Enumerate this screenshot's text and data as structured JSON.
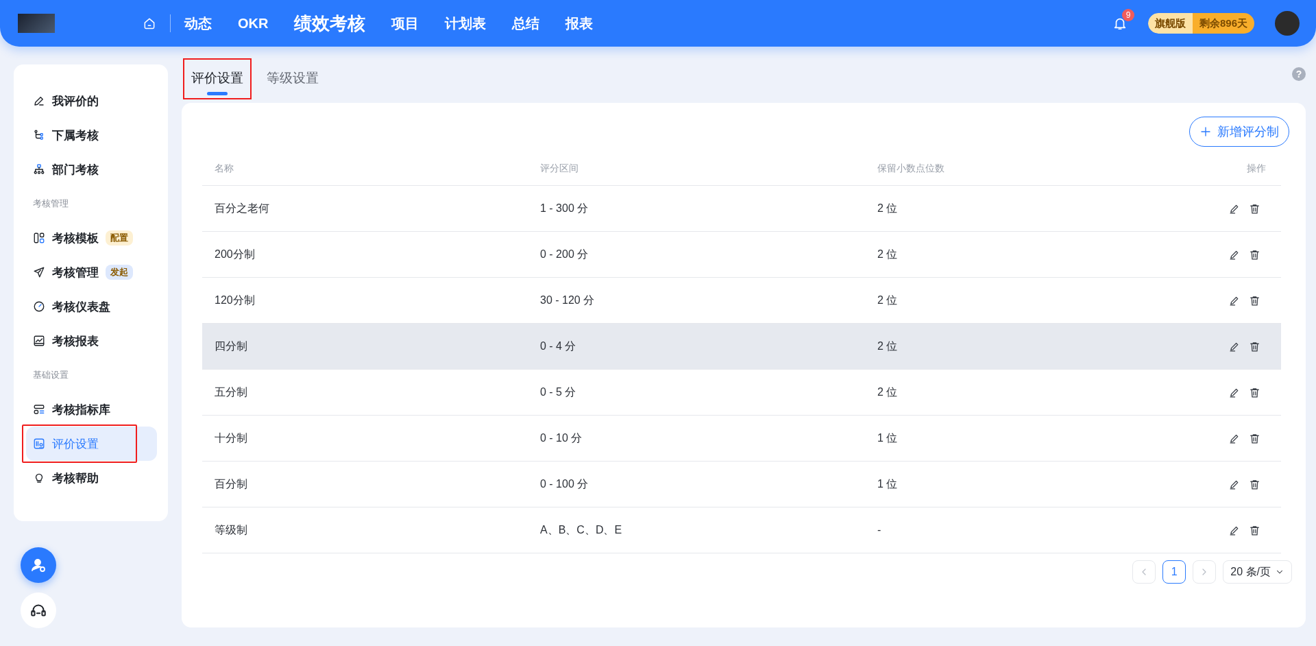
{
  "header": {
    "nav": [
      {
        "label": "动态",
        "selected": false
      },
      {
        "label": "OKR",
        "selected": false
      },
      {
        "label": "绩效考核",
        "selected": true
      },
      {
        "label": "项目",
        "selected": false
      },
      {
        "label": "计划表",
        "selected": false
      },
      {
        "label": "总结",
        "selected": false
      },
      {
        "label": "报表",
        "selected": false
      }
    ],
    "notification_count": "9",
    "plan": {
      "edition": "旗舰版",
      "remaining": "剩余896天"
    }
  },
  "sidebar": {
    "items": [
      {
        "kind": "item",
        "label": "我评价的",
        "selected": false,
        "annotated": false
      },
      {
        "kind": "item",
        "label": "下属考核",
        "selected": false,
        "annotated": false
      },
      {
        "kind": "item",
        "label": "部门考核",
        "selected": false,
        "annotated": false
      },
      {
        "kind": "section",
        "label": "考核管理"
      },
      {
        "kind": "item",
        "label": "考核模板",
        "selected": false,
        "annotated": false,
        "badge": {
          "text": "配置",
          "color": "#fdf0d2"
        }
      },
      {
        "kind": "item",
        "label": "考核管理",
        "selected": false,
        "annotated": false,
        "badge": {
          "text": "发起",
          "color": "#dde8fd"
        }
      },
      {
        "kind": "item",
        "label": "考核仪表盘",
        "selected": false,
        "annotated": false
      },
      {
        "kind": "item",
        "label": "考核报表",
        "selected": false,
        "annotated": false
      },
      {
        "kind": "section",
        "label": "基础设置"
      },
      {
        "kind": "item",
        "label": "考核指标库",
        "selected": false,
        "annotated": false
      },
      {
        "kind": "item",
        "label": "评价设置",
        "selected": true,
        "annotated": true
      },
      {
        "kind": "item",
        "label": "考核帮助",
        "selected": false,
        "annotated": false
      }
    ]
  },
  "help": "?",
  "tabs": [
    {
      "label": "评价设置",
      "selected": true,
      "annotated": true
    },
    {
      "label": "等级设置",
      "selected": false,
      "annotated": false
    }
  ],
  "add_button": "新增评分制",
  "table": {
    "columns": [
      "名称",
      "评分区间",
      "保留小数点位数",
      "操作"
    ],
    "rows": [
      {
        "name": "百分之老何",
        "range": "1 - 300 分",
        "decimals": "2 位",
        "hovered": false
      },
      {
        "name": "200分制",
        "range": "0 - 200 分",
        "decimals": "2 位",
        "hovered": false
      },
      {
        "name": "120分制",
        "range": "30 - 120 分",
        "decimals": "2 位",
        "hovered": false
      },
      {
        "name": "四分制",
        "range": "0 - 4 分",
        "decimals": "2 位",
        "hovered": true
      },
      {
        "name": "五分制",
        "range": "0 - 5 分",
        "decimals": "2 位",
        "hovered": false
      },
      {
        "name": "十分制",
        "range": "0 - 10 分",
        "decimals": "1 位",
        "hovered": false
      },
      {
        "name": "百分制",
        "range": "0 - 100 分",
        "decimals": "1 位",
        "hovered": false
      },
      {
        "name": "等级制",
        "range": "A、B、C、D、E",
        "decimals": "-",
        "hovered": false
      }
    ]
  },
  "pagination": {
    "pages": [
      {
        "label": "1",
        "selected": true
      }
    ],
    "page_size": "20 条/页"
  }
}
